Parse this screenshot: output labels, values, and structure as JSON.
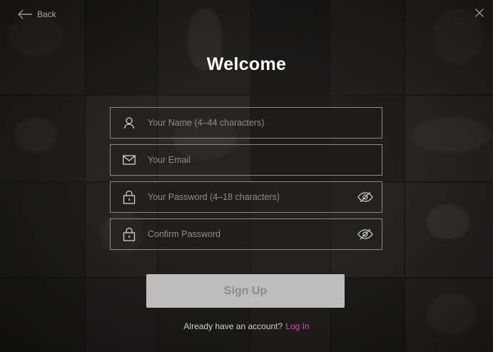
{
  "window": {
    "back_label": "Back",
    "title": "Welcome"
  },
  "form": {
    "name": {
      "value": "",
      "placeholder": "Your Name (4–44 characters)",
      "icon": "user-icon"
    },
    "email": {
      "value": "",
      "placeholder": "Your Email",
      "icon": "envelope-icon"
    },
    "password": {
      "value": "",
      "placeholder": "Your Password (4–18 characters)",
      "icon": "lock-icon",
      "toggle_icon": "eye-hidden-icon"
    },
    "confirm": {
      "value": "",
      "placeholder": "Confirm Password",
      "icon": "lock-icon",
      "toggle_icon": "eye-hidden-icon"
    }
  },
  "signup": {
    "label": "Sign Up"
  },
  "footer": {
    "prompt": "Already have an account?",
    "login_label": "Log In"
  },
  "colors": {
    "background": "#1c1b1a",
    "field_border": "#8b8986",
    "button_bg": "#bdbdbd",
    "button_text": "#8d8d8d",
    "link": "#c45aa8",
    "title": "#ffffff"
  }
}
